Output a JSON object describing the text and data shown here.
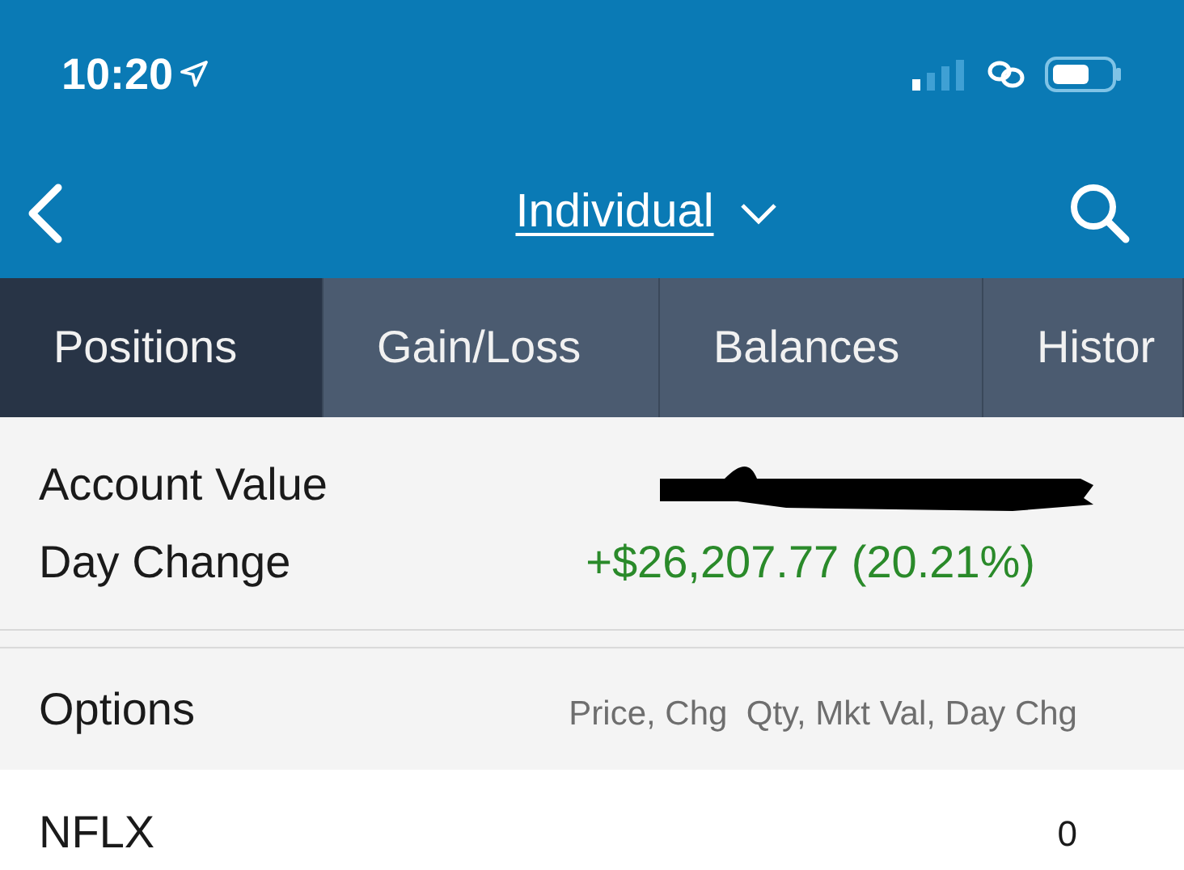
{
  "status_bar": {
    "time": "10:20"
  },
  "nav": {
    "title": "Individual"
  },
  "tabs": [
    {
      "label": "Positions",
      "selected": true
    },
    {
      "label": "Gain/Loss",
      "selected": false
    },
    {
      "label": "Balances",
      "selected": false
    },
    {
      "label": "Histor",
      "selected": false
    }
  ],
  "summary": [
    {
      "label": "Account Value",
      "kind": "redacted"
    },
    {
      "label": "Day Change",
      "kind": "value",
      "value": "+$26,207.77 (20.21%)"
    }
  ],
  "section": {
    "title": "Options",
    "columns": "Price, Chg  Qty, Mkt Val, Day Chg"
  },
  "rows": [
    {
      "symbol": "NFLX",
      "qty": "0"
    }
  ]
}
